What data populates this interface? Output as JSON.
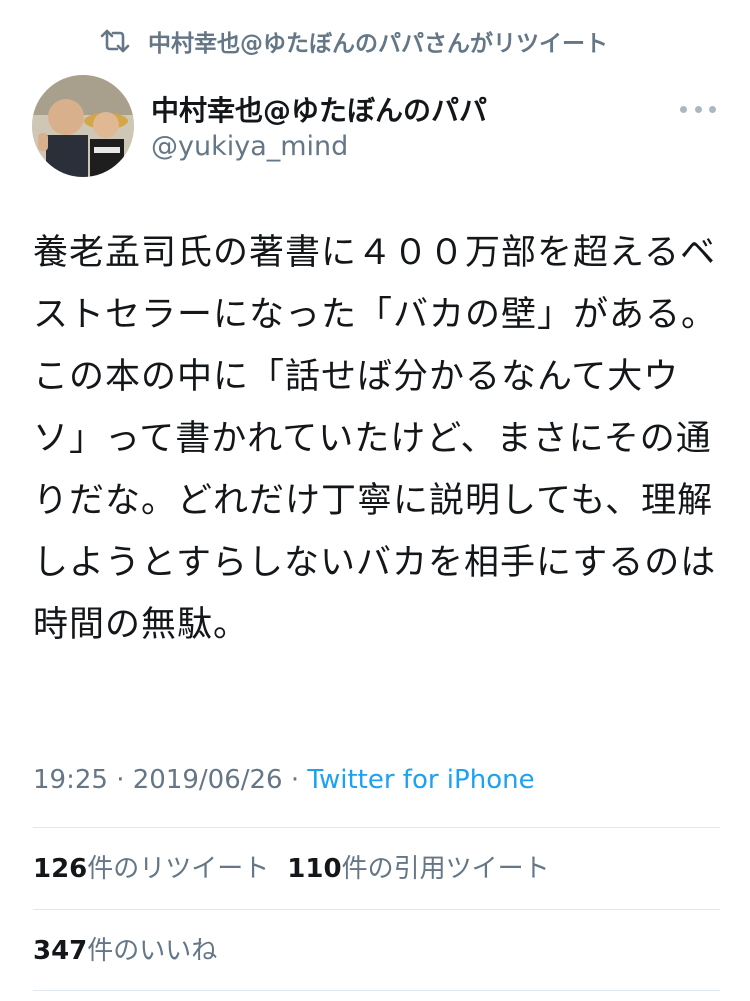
{
  "retweet_banner": {
    "text": "中村幸也@ゆたぼんのパパさんがリツイート",
    "icon": "retweet-icon"
  },
  "author": {
    "display_name": "中村幸也@ゆたぼんのパパ",
    "handle": "@yukiya_mind",
    "more_icon": "more-options-icon"
  },
  "tweet": {
    "text": "養老孟司氏の著書に４００万部を超えるベストセラーになった「バカの壁」がある。この本の中に「話せば分かるなんて大ウソ」って書かれていたけど、まさにその通りだな。どれだけ丁寧に説明しても、理解しようとすらしないバカを相手にするのは時間の無駄。"
  },
  "meta": {
    "time": "19:25",
    "sep1": " · ",
    "date": "2019/06/26",
    "sep2": " · ",
    "source": "Twitter for iPhone"
  },
  "stats": {
    "retweets_count": "126",
    "retweets_label": "件のリツイート",
    "quotes_count": "110",
    "quotes_label": "件の引用ツイート",
    "likes_count": "347",
    "likes_label": "件のいいね"
  },
  "colors": {
    "text": "#14171a",
    "secondary": "#657786",
    "link": "#1da1f2",
    "divider": "#e1e8ed"
  }
}
